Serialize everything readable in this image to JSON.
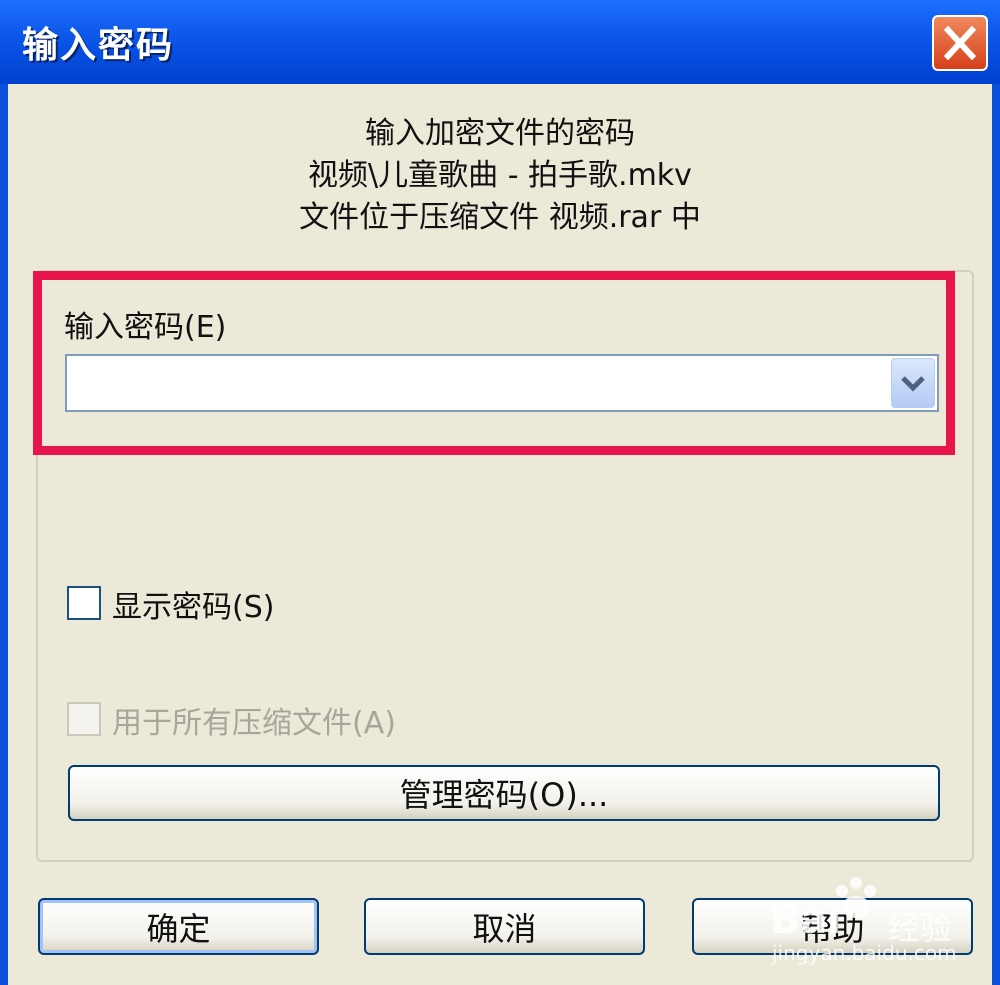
{
  "window": {
    "title": "输入密码",
    "close_label": "关闭"
  },
  "info": {
    "line1": "输入加密文件的密码",
    "line2": "视频\\儿童歌曲 - 拍手歌.mkv",
    "line3": "文件位于压缩文件 视频.rar 中"
  },
  "password": {
    "label": "输入密码(E)",
    "value": "",
    "dropdown_icon": "chevron-down-icon"
  },
  "options": {
    "show_password": {
      "label": "显示密码(S)",
      "checked": false
    },
    "use_for_all": {
      "label": "用于所有压缩文件(A)",
      "checked": false,
      "enabled": false
    }
  },
  "buttons": {
    "manage": "管理密码(O)...",
    "ok": "确定",
    "cancel": "取消",
    "help": "帮助"
  },
  "watermark": {
    "brand": "Bai",
    "brand_suffix": "经验",
    "url": "jingyan.baidu.com"
  },
  "colors": {
    "titlebar": "#0b56e8",
    "highlight": "#e8144c",
    "dialog_bg": "#ece9d8"
  }
}
